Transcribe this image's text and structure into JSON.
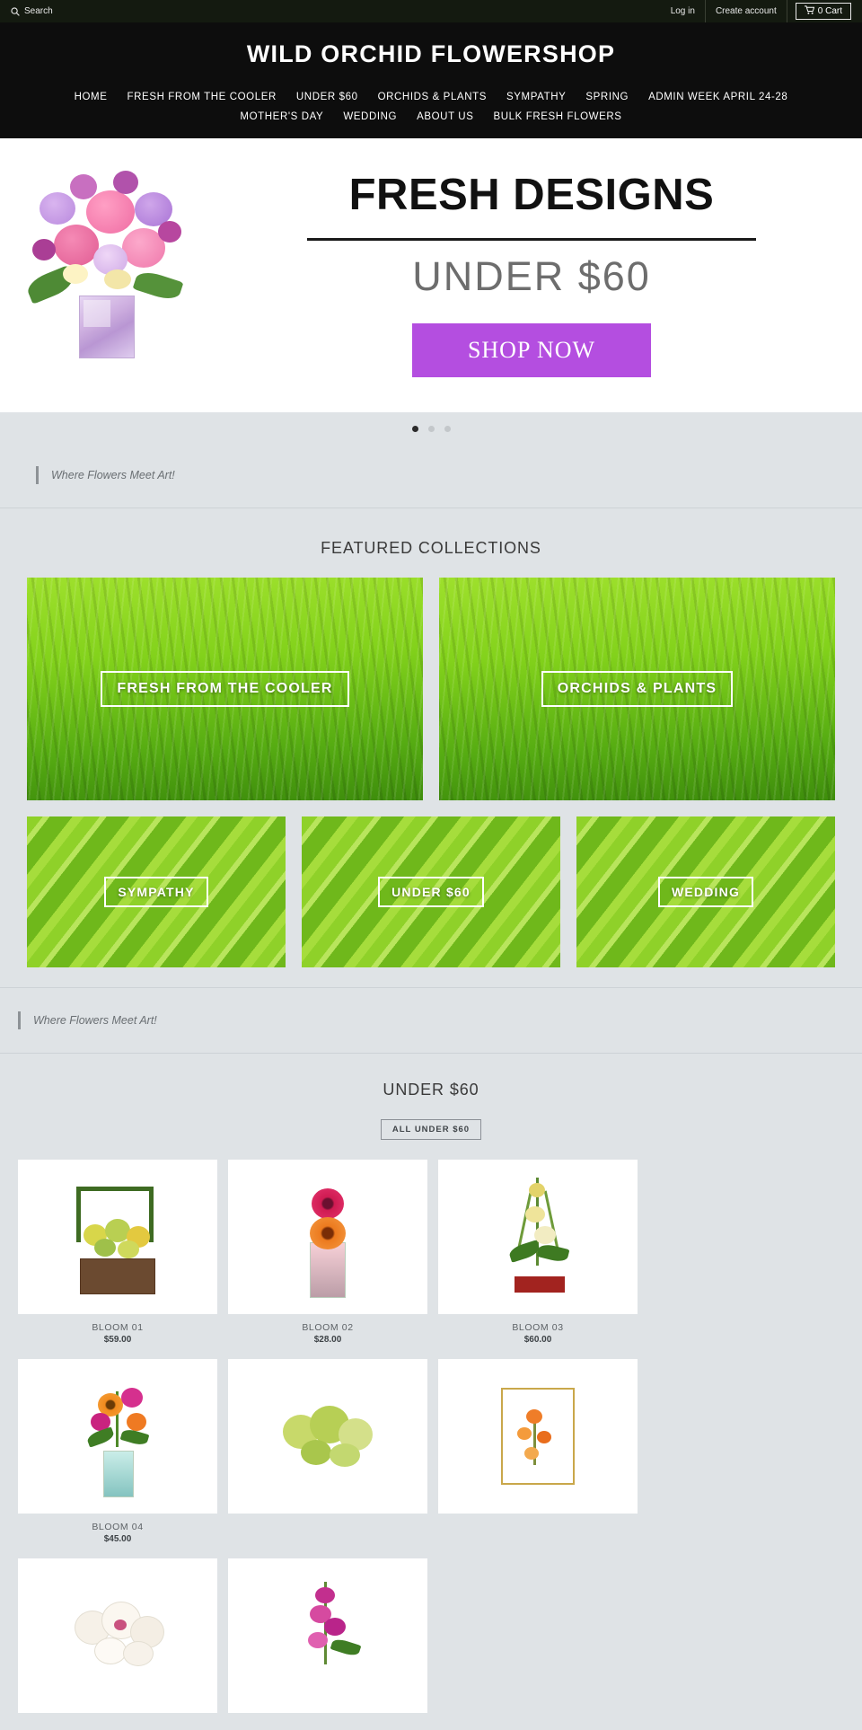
{
  "utility_bar": {
    "search_label": "Search",
    "search_icon": "search-icon",
    "login_label": "Log in",
    "create_account_label": "Create account",
    "cart_label": "0 Cart",
    "cart_icon": "shopping-cart-icon"
  },
  "header": {
    "site_title": "WILD ORCHID FLOWERSHOP",
    "nav_row_1": [
      "HOME",
      "FRESH FROM THE COOLER",
      "UNDER  $60",
      "ORCHIDS & PLANTS",
      "SYMPATHY",
      "SPRING",
      "ADMIN WEEK APRIL 24-28"
    ],
    "nav_row_2": [
      "MOTHER'S DAY",
      "WEDDING",
      "ABOUT US",
      "BULK FRESH FLOWERS"
    ]
  },
  "hero": {
    "headline": "FRESH DESIGNS",
    "subheadline": "UNDER $60",
    "cta_label": "SHOP NOW",
    "cta_color": "#b44ee0",
    "slide_count": 3,
    "active_slide": 1
  },
  "tagline_top": "Where Flowers Meet Art!",
  "tagline_bottom": "Where Flowers Meet Art!",
  "featured": {
    "title": "FEATURED COLLECTIONS",
    "big_cards": [
      {
        "label": "FRESH FROM THE COOLER"
      },
      {
        "label": "ORCHIDS & PLANTS"
      }
    ],
    "small_cards": [
      {
        "label": "SYMPATHY"
      },
      {
        "label": "UNDER $60"
      },
      {
        "label": "WEDDING"
      }
    ]
  },
  "products_section": {
    "title": "UNDER $60",
    "all_button_label": "ALL UNDER $60",
    "items": [
      {
        "name": "BLOOM 01",
        "price": "$59.00",
        "style": "basket"
      },
      {
        "name": "BLOOM 02",
        "price": "$28.00",
        "style": "gerbera-vase"
      },
      {
        "name": "BLOOM 03",
        "price": "$60.00",
        "style": "tall-arrangement"
      },
      {
        "name": "BLOOM 04",
        "price": "$45.00",
        "style": "bright-vase"
      },
      {
        "name": "",
        "price": "",
        "style": "green-cymbidium"
      },
      {
        "name": "",
        "price": "",
        "style": "framed-orchid"
      },
      {
        "name": "",
        "price": "",
        "style": "white-orchid"
      },
      {
        "name": "",
        "price": "",
        "style": "pink-spray"
      }
    ]
  }
}
